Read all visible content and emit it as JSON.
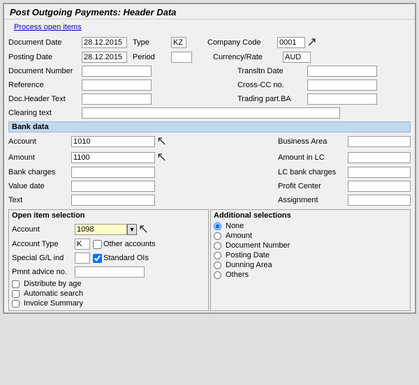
{
  "title": "Post Outgoing Payments: Header Data",
  "process_open_items": "Process open items",
  "fields": {
    "document_date_label": "Document Date",
    "document_date_value": "28.12.2015",
    "type_label": "Type",
    "type_value": "KZ",
    "company_code_label": "Company Code",
    "company_code_value": "0001",
    "posting_date_label": "Posting Date",
    "posting_date_value": "28.12.2015",
    "period_label": "Period",
    "period_value": "",
    "currency_rate_label": "Currency/Rate",
    "currency_rate_value": "AUD",
    "document_number_label": "Document Number",
    "translation_date_label": "Transltn Date",
    "reference_label": "Reference",
    "cross_cc_label": "Cross-CC no.",
    "doc_header_label": "Doc.Header Text",
    "trading_part_label": "Trading part.BA",
    "clearing_text_label": "Clearing text"
  },
  "bank_data": {
    "section_label": "Bank data",
    "account_label": "Account",
    "account_value": "1010",
    "business_area_label": "Business Area",
    "amount_label": "Amount",
    "amount_value": "1100",
    "amount_lc_label": "Amount in LC",
    "bank_charges_label": "Bank charges",
    "lc_bank_charges_label": "LC bank charges",
    "value_date_label": "Value date",
    "profit_center_label": "Profit Center",
    "text_label": "Text",
    "assignment_label": "Assignment"
  },
  "open_item_selection": {
    "section_label": "Open item selection",
    "account_label": "Account",
    "account_value": "1098",
    "account_type_label": "Account Type",
    "account_type_value": "K",
    "other_accounts_label": "Other accounts",
    "special_gl_label": "Special G/L ind",
    "standard_ois_label": "Standard OIs",
    "pmnt_advice_label": "Pmnt advice no.",
    "distribute_age_label": "Distribute by age",
    "automatic_search_label": "Automatic search",
    "invoice_summary_label": "Invoice Summary"
  },
  "additional_selections": {
    "section_label": "Additional selections",
    "none_label": "None",
    "amount_label": "Amount",
    "document_number_label": "Document Number",
    "posting_date_label": "Posting Date",
    "dunning_area_label": "Dunning Area",
    "others_label": "Others"
  }
}
